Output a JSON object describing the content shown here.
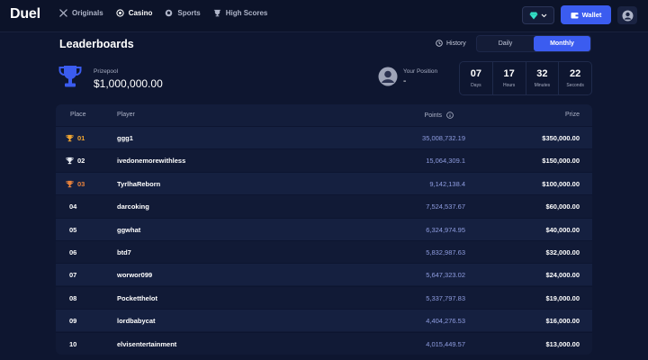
{
  "brand": {
    "logo": "Duel",
    "accent": "#3b5cf0",
    "gold": "#f0a531",
    "bronze": "#e8823c",
    "silver": "#e8ecf4"
  },
  "nav": [
    {
      "label": "Originals",
      "icon": "cross-swords-icon",
      "active": false
    },
    {
      "label": "Casino",
      "icon": "target-icon",
      "active": true
    },
    {
      "label": "Sports",
      "icon": "ball-icon",
      "active": false
    },
    {
      "label": "High Scores",
      "icon": "trophy-icon",
      "active": false
    }
  ],
  "header": {
    "currency_icon": "gem-icon",
    "wallet_label": "Wallet",
    "wallet_icon": "wallet-icon",
    "profile_icon": "user-icon"
  },
  "leaderboard": {
    "title": "Leaderboards",
    "history_label": "History",
    "tabs": [
      {
        "label": "Daily",
        "active": false
      },
      {
        "label": "Monthly",
        "active": true
      }
    ],
    "prizepool_label": "Prizepool",
    "prizepool_value": "$1,000,000.00",
    "position_label": "Your Position",
    "position_value": "-",
    "countdown": [
      {
        "value": "07",
        "unit": "Days"
      },
      {
        "value": "17",
        "unit": "Hours"
      },
      {
        "value": "32",
        "unit": "Minutes"
      },
      {
        "value": "22",
        "unit": "Seconds"
      }
    ],
    "columns": {
      "place": "Place",
      "player": "Player",
      "points": "Points",
      "prize": "Prize"
    },
    "rows": [
      {
        "place": "01",
        "player": "ggg1",
        "points": "35,008,732.19",
        "prize": "$350,000.00",
        "medal": "gold"
      },
      {
        "place": "02",
        "player": "ivedonemorewithless",
        "points": "15,064,309.1",
        "prize": "$150,000.00",
        "medal": "silver"
      },
      {
        "place": "03",
        "player": "TyrlhaReborn",
        "points": "9,142,138.4",
        "prize": "$100,000.00",
        "medal": "bronze"
      },
      {
        "place": "04",
        "player": "darcoking",
        "points": "7,524,537.67",
        "prize": "$60,000.00",
        "medal": ""
      },
      {
        "place": "05",
        "player": "ggwhat",
        "points": "6,324,974.95",
        "prize": "$40,000.00",
        "medal": ""
      },
      {
        "place": "06",
        "player": "btd7",
        "points": "5,832,987.63",
        "prize": "$32,000.00",
        "medal": ""
      },
      {
        "place": "07",
        "player": "worwor099",
        "points": "5,647,323.02",
        "prize": "$24,000.00",
        "medal": ""
      },
      {
        "place": "08",
        "player": "Pocketthelot",
        "points": "5,337,797.83",
        "prize": "$19,000.00",
        "medal": ""
      },
      {
        "place": "09",
        "player": "lordbabycat",
        "points": "4,404,276.53",
        "prize": "$16,000.00",
        "medal": ""
      },
      {
        "place": "10",
        "player": "elvisentertainment",
        "points": "4,015,449.57",
        "prize": "$13,000.00",
        "medal": ""
      }
    ]
  }
}
